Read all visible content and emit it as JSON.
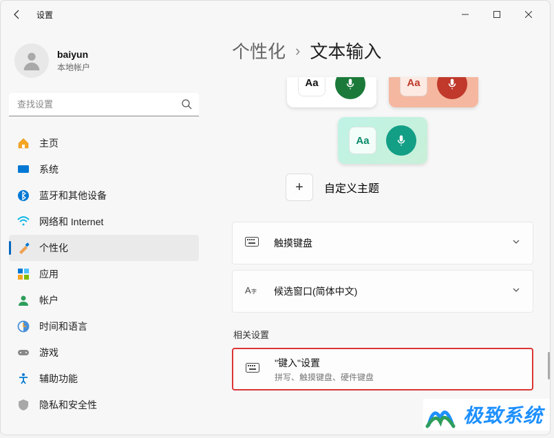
{
  "window": {
    "title": "设置"
  },
  "account": {
    "name": "baiyun",
    "type": "本地帐户"
  },
  "search": {
    "placeholder": "查找设置"
  },
  "nav": [
    {
      "label": "主页",
      "icon": "home"
    },
    {
      "label": "系统",
      "icon": "system"
    },
    {
      "label": "蓝牙和其他设备",
      "icon": "bluetooth"
    },
    {
      "label": "网络和 Internet",
      "icon": "wifi"
    },
    {
      "label": "个性化",
      "icon": "brush",
      "active": true
    },
    {
      "label": "应用",
      "icon": "apps"
    },
    {
      "label": "帐户",
      "icon": "account"
    },
    {
      "label": "时间和语言",
      "icon": "time"
    },
    {
      "label": "游戏",
      "icon": "game"
    },
    {
      "label": "辅助功能",
      "icon": "accessibility"
    },
    {
      "label": "隐私和安全性",
      "icon": "privacy"
    }
  ],
  "breadcrumb": {
    "parent": "个性化",
    "current": "文本输入"
  },
  "themes": {
    "aa_label": "Aa",
    "cards": [
      {
        "bg": "#ffffff",
        "aaColor": "#111",
        "micBg": "#1b7a3a"
      },
      {
        "bg": "#f5b7a0",
        "aaColor": "#c0392b",
        "micBg": "#c0392b"
      },
      {
        "bg": "linear-gradient(135deg,#bff3e6,#c9f0d8)",
        "aaColor": "#0a8a6a",
        "micBg": "#139e86"
      }
    ]
  },
  "customTheme": "自定义主题",
  "rows": {
    "touchKeyboard": "触摸键盘",
    "candidate": "候选窗口(简体中文)"
  },
  "related": {
    "label": "相关设置",
    "typing": {
      "title": "\"键入\"设置",
      "sub": "拼写、触摸键盘、硬件键盘"
    }
  },
  "watermark": "极致系统"
}
